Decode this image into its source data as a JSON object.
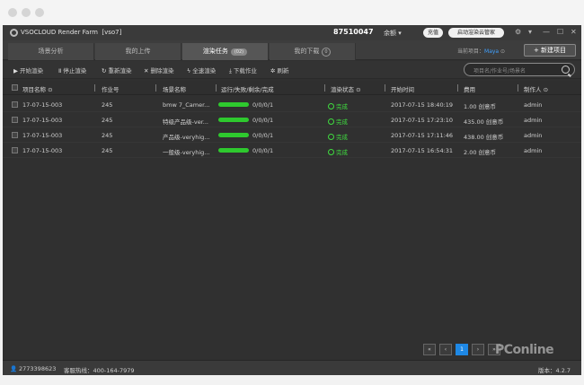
{
  "app": {
    "title": "VSOCLOUD Render Farm",
    "project_tag": "[vso7]",
    "account": "87510047",
    "balance_label": "余额",
    "recharge_label": "充值",
    "butler_label": "启动渲染云管家"
  },
  "tabs": [
    {
      "label": "场景分析"
    },
    {
      "label": "我的上传"
    },
    {
      "label": "渲染任务",
      "badge": "(02)"
    },
    {
      "label": "我的下载",
      "badge": "0"
    }
  ],
  "project_selector": {
    "label": "当前项目：",
    "value": "Maya"
  },
  "new_project_label": "+ 新建项目",
  "toolbar": [
    {
      "icon": "play-icon",
      "glyph": "▶",
      "label": "开始渲染"
    },
    {
      "icon": "pause-icon",
      "glyph": "Ⅱ",
      "label": "停止渲染"
    },
    {
      "icon": "refresh-icon",
      "glyph": "↻",
      "label": "重新渲染"
    },
    {
      "icon": "delete-icon",
      "glyph": "✕",
      "label": "删除渲染"
    },
    {
      "icon": "flash-icon",
      "glyph": "ϟ",
      "label": "全速渲染"
    },
    {
      "icon": "download-icon",
      "glyph": "⤓",
      "label": "下载作业"
    },
    {
      "icon": "sync-icon",
      "glyph": "✲",
      "label": "刷新"
    }
  ],
  "search": {
    "placeholder": "项目名/作业号/场景名"
  },
  "table": {
    "headers": [
      "项目名称",
      "作业号",
      "场景名称",
      "运行/失败/剩余/完成",
      "渲染状态",
      "开始时间",
      "费用",
      "制作人"
    ],
    "rows": [
      {
        "project": "17-07-15-003",
        "job": "245",
        "scene": "bmw 7_Camer...",
        "counts": "0/0/0/1",
        "progress": 1.0,
        "status": "完成",
        "start": "2017-07-15 18:40:19",
        "cost": "1.00 创意币",
        "owner": "admin"
      },
      {
        "project": "17-07-15-003",
        "job": "245",
        "scene": "特级产品级-ver...",
        "counts": "0/0/0/1",
        "progress": 1.0,
        "status": "完成",
        "start": "2017-07-15 17:23:10",
        "cost": "435.00 创意币",
        "owner": "admin"
      },
      {
        "project": "17-07-15-003",
        "job": "245",
        "scene": "产品级-veryhig...",
        "counts": "0/0/0/1",
        "progress": 1.0,
        "status": "完成",
        "start": "2017-07-15 17:11:46",
        "cost": "438.00 创意币",
        "owner": "admin"
      },
      {
        "project": "17-07-15-003",
        "job": "245",
        "scene": "一般级-veryhig...",
        "counts": "0/0/0/1",
        "progress": 1.0,
        "status": "完成",
        "start": "2017-07-15 16:54:31",
        "cost": "2.00 创意币",
        "owner": "admin"
      }
    ]
  },
  "pagination": {
    "first": "«",
    "prev": "‹",
    "current": "1",
    "next": "›",
    "last": "»"
  },
  "footer": {
    "qq": "2773398623",
    "hotline": "客服热线：400-164-7979",
    "version": "版本：4.2.7"
  },
  "watermark": "PConline",
  "colors": {
    "accent": "#1e88e5",
    "success": "#3fdc3f",
    "progress": "#2ec92e"
  }
}
